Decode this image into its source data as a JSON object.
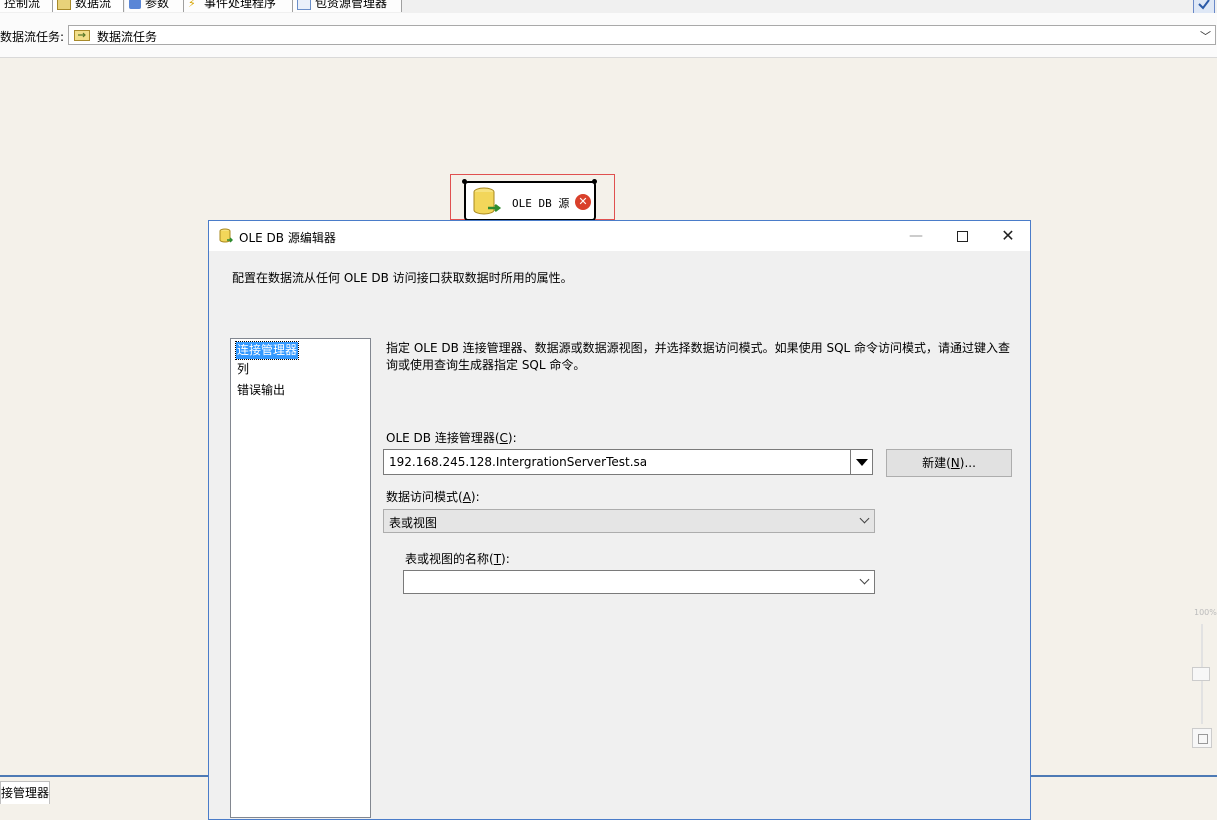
{
  "tabs": [
    {
      "label": "控制流",
      "icon": "control-flow-icon"
    },
    {
      "label": "数据流",
      "icon": "data-flow-icon"
    },
    {
      "label": "参数",
      "icon": "parameters-icon"
    },
    {
      "label": "事件处理程序",
      "icon": "event-handler-icon"
    },
    {
      "label": "包资源管理器",
      "icon": "package-explorer-icon"
    }
  ],
  "taskbar": {
    "label": "数据流任务:",
    "selected": "数据流任务"
  },
  "canvas": {
    "component_label": "OLE DB 源",
    "error_glyph": "✕"
  },
  "zoom": {
    "level": "100%"
  },
  "bottom_panel": {
    "tab_label": "连接管理器"
  },
  "dialog": {
    "title": "OLE DB 源编辑器",
    "header_desc": "配置在数据流从任何 OLE DB 访问接口获取数据时所用的属性。",
    "nav_items": [
      "连接管理器",
      "列",
      "错误输出"
    ],
    "content_desc": "指定 OLE DB 连接管理器、数据源或数据源视图，并选择数据访问模式。如果使用 SQL 命令访问模式，请通过键入查询或使用查询生成器指定 SQL 命令。",
    "conn_label_pre": "OLE DB 连接管理器(",
    "conn_label_key": "C",
    "conn_label_post": "):",
    "conn_value": "192.168.245.128.IntergrationServerTest.sa",
    "new_button_pre": "新建(",
    "new_button_key": "N",
    "new_button_post": ")...",
    "access_label_pre": "数据访问模式(",
    "access_label_key": "A",
    "access_label_post": "):",
    "access_value": "表或视图",
    "table_label_pre": "表或视图的名称(",
    "table_label_key": "T",
    "table_label_post": "):",
    "table_value": "",
    "window_controls": {
      "minimize": "—",
      "close": "✕"
    }
  },
  "colors": {
    "canvas_bg": "#f4f1ea",
    "selection_blue": "#3399ff",
    "dialog_border": "#4a7cc9",
    "error_red": "#d9402b"
  }
}
